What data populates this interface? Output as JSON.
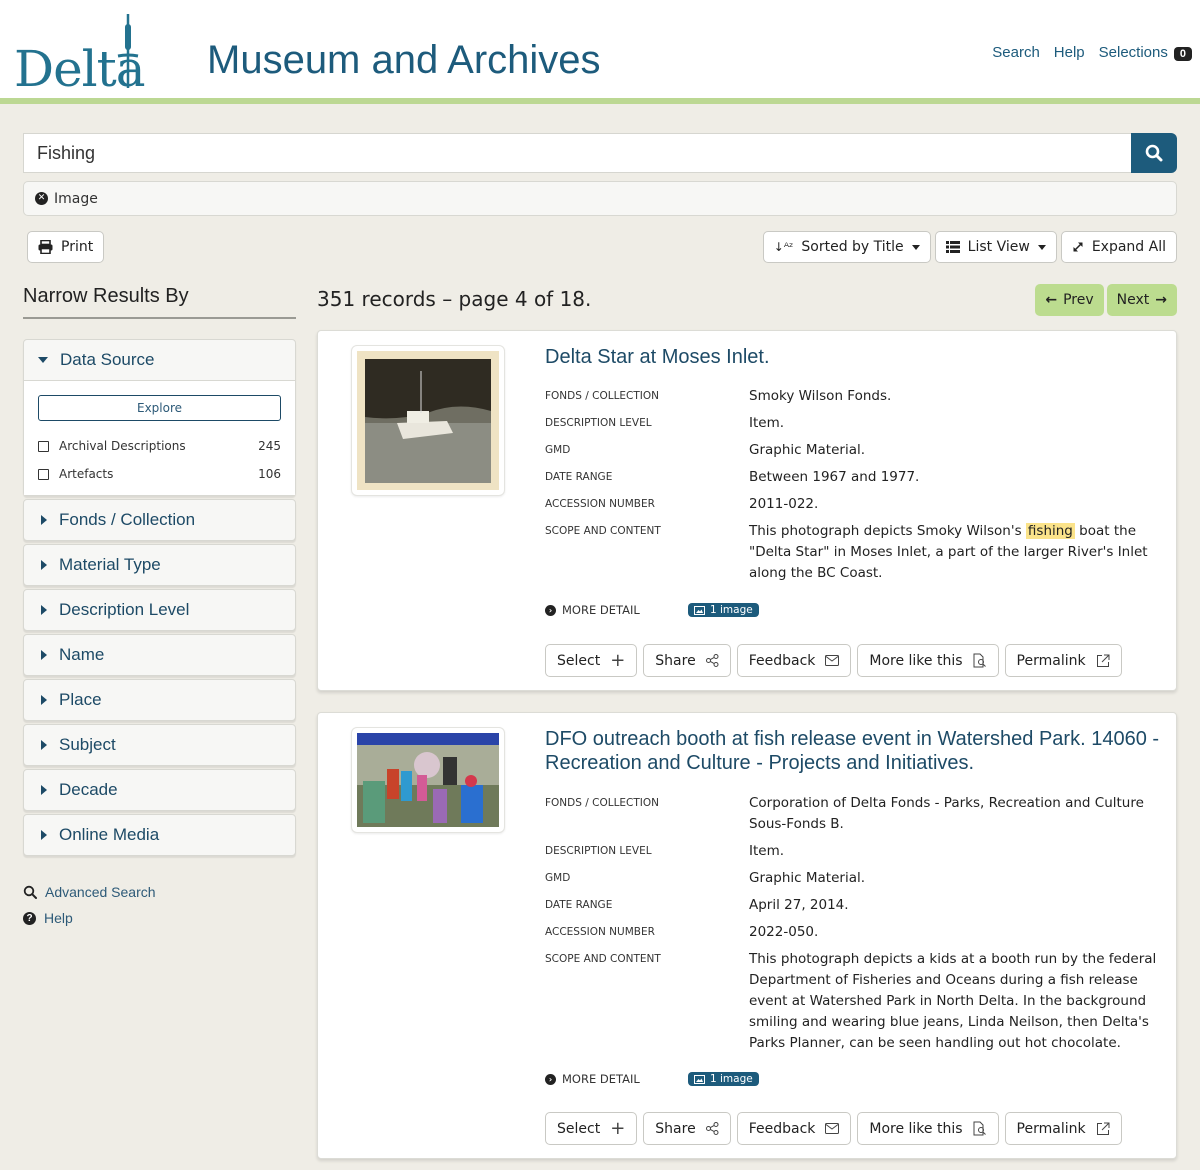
{
  "header": {
    "logo_text": "Delta",
    "site_title": "Museum and Archives",
    "nav": [
      {
        "label": "Search"
      },
      {
        "label": "Help"
      },
      {
        "label": "Selections"
      }
    ],
    "selections_count": "0",
    "accent_color": "#bcd893",
    "brand_color": "#1d5b7c"
  },
  "search": {
    "value": "Fishing",
    "placeholder": "",
    "active_filters": [
      {
        "label": "Image"
      }
    ]
  },
  "toolbar": {
    "print_label": "Print",
    "sort_label": "Sorted by Title",
    "view_label": "List View",
    "expand_label": "Expand All"
  },
  "sidebar": {
    "title": "Narrow Results By",
    "data_source": {
      "label": "Data Source",
      "explore_label": "Explore",
      "options": [
        {
          "label": "Archival Descriptions",
          "count": "245"
        },
        {
          "label": "Artefacts",
          "count": "106"
        }
      ]
    },
    "facets": [
      {
        "label": "Fonds / Collection"
      },
      {
        "label": "Material Type"
      },
      {
        "label": "Description Level"
      },
      {
        "label": "Name"
      },
      {
        "label": "Place"
      },
      {
        "label": "Subject"
      },
      {
        "label": "Decade"
      },
      {
        "label": "Online Media"
      }
    ],
    "links": [
      {
        "label": "Advanced Search"
      },
      {
        "label": "Help"
      }
    ]
  },
  "results": {
    "summary": "351 records – page 4 of 18.",
    "prev_label": "Prev",
    "next_label": "Next",
    "highlight_color": "#fbe38a",
    "records": [
      {
        "title": "Delta Star at Moses Inlet.",
        "fields": [
          {
            "label": "Fonds / Collection",
            "value": "Smoky Wilson Fonds."
          },
          {
            "label": "Description Level",
            "value": "Item."
          },
          {
            "label": "GMD",
            "value": "Graphic Material."
          },
          {
            "label": "Date Range",
            "value": "Between 1967 and 1977."
          },
          {
            "label": "Accession Number",
            "value": "2011-022."
          }
        ],
        "scope_label": "Scope and Content",
        "scope_before": "This photograph depicts Smoky Wilson's ",
        "scope_highlight": "fishing",
        "scope_after": " boat the \"Delta Star\" in Moses Inlet, a part of the larger River's Inlet along the BC Coast.",
        "more_detail_label": "MORE DETAIL",
        "media_badge": "1 image",
        "actions": [
          {
            "label": "Select"
          },
          {
            "label": "Share"
          },
          {
            "label": "Feedback"
          },
          {
            "label": "More like this"
          },
          {
            "label": "Permalink"
          }
        ]
      },
      {
        "title": "DFO outreach booth at fish release event in Watershed Park. 14060 - Recreation and Culture - Projects and Initiatives.",
        "fields": [
          {
            "label": "Fonds / Collection",
            "value": "Corporation of Delta Fonds - Parks, Recreation and Culture Sous-Fonds B."
          },
          {
            "label": "Description Level",
            "value": "Item."
          },
          {
            "label": "GMD",
            "value": "Graphic Material."
          },
          {
            "label": "Date Range",
            "value": "April 27, 2014."
          },
          {
            "label": "Accession Number",
            "value": "2022-050."
          }
        ],
        "scope_label": "Scope and Content",
        "scope_before": "This photograph depicts a kids at a booth run by the federal Department of Fisheries and Oceans during a fish release event at Watershed Park in North Delta. In the background smiling and wearing blue jeans, Linda Neilson, then Delta's Parks Planner, can be seen handling out hot chocolate.",
        "scope_highlight": "",
        "scope_after": "",
        "more_detail_label": "MORE DETAIL",
        "media_badge": "1 image",
        "actions": [
          {
            "label": "Select"
          },
          {
            "label": "Share"
          },
          {
            "label": "Feedback"
          },
          {
            "label": "More like this"
          },
          {
            "label": "Permalink"
          }
        ]
      }
    ]
  }
}
